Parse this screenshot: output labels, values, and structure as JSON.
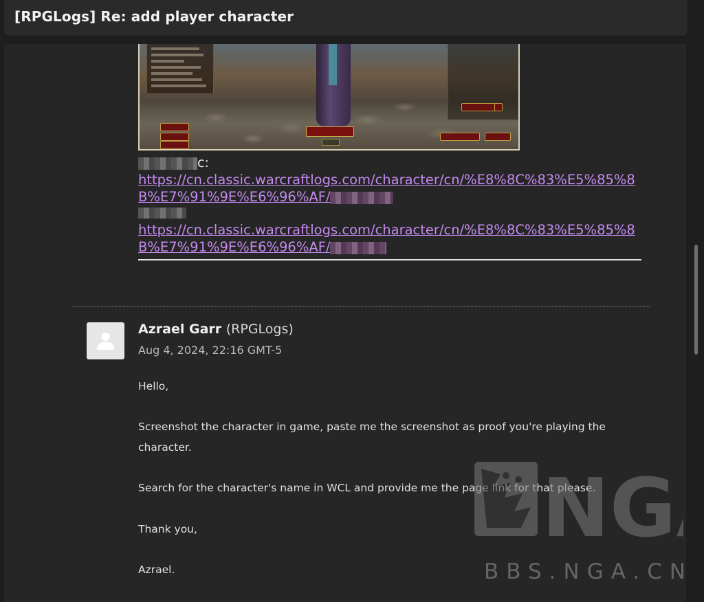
{
  "window": {
    "title": "[RPGLogs] Re: add player character"
  },
  "prev_message": {
    "label_suffix": "c:",
    "link_1": "https://cn.classic.warcraftlogs.com/character/cn/%E8%8C%83%E5%85%8B%E7%91%9E%E6%96%AF/",
    "link_2": "https://cn.classic.warcraftlogs.com/character/cn/%E8%8C%83%E5%85%8B%E7%91%9E%E6%96%AF/"
  },
  "post": {
    "author_name": "Azrael Garr",
    "author_org": "(RPGLogs)",
    "date": "Aug 4, 2024, 22:16 GMT-5",
    "paragraphs": [
      "Hello,",
      "Screenshot the character in game, paste me the screenshot as proof you're playing the character.",
      "Search for the character's name in WCL and provide me the page link for that please.",
      "Thank you,",
      "Azrael."
    ]
  },
  "watermark": {
    "logo_text": "NGA",
    "site_text": "BBS.NGA.CN"
  },
  "icons": {
    "avatar": "user-silhouette-icon"
  },
  "colors": {
    "background": "#1e1e1e",
    "panel": "#262626",
    "title_bar": "#2a2a2a",
    "link": "#c58af0",
    "text": "#e0e0e0"
  }
}
